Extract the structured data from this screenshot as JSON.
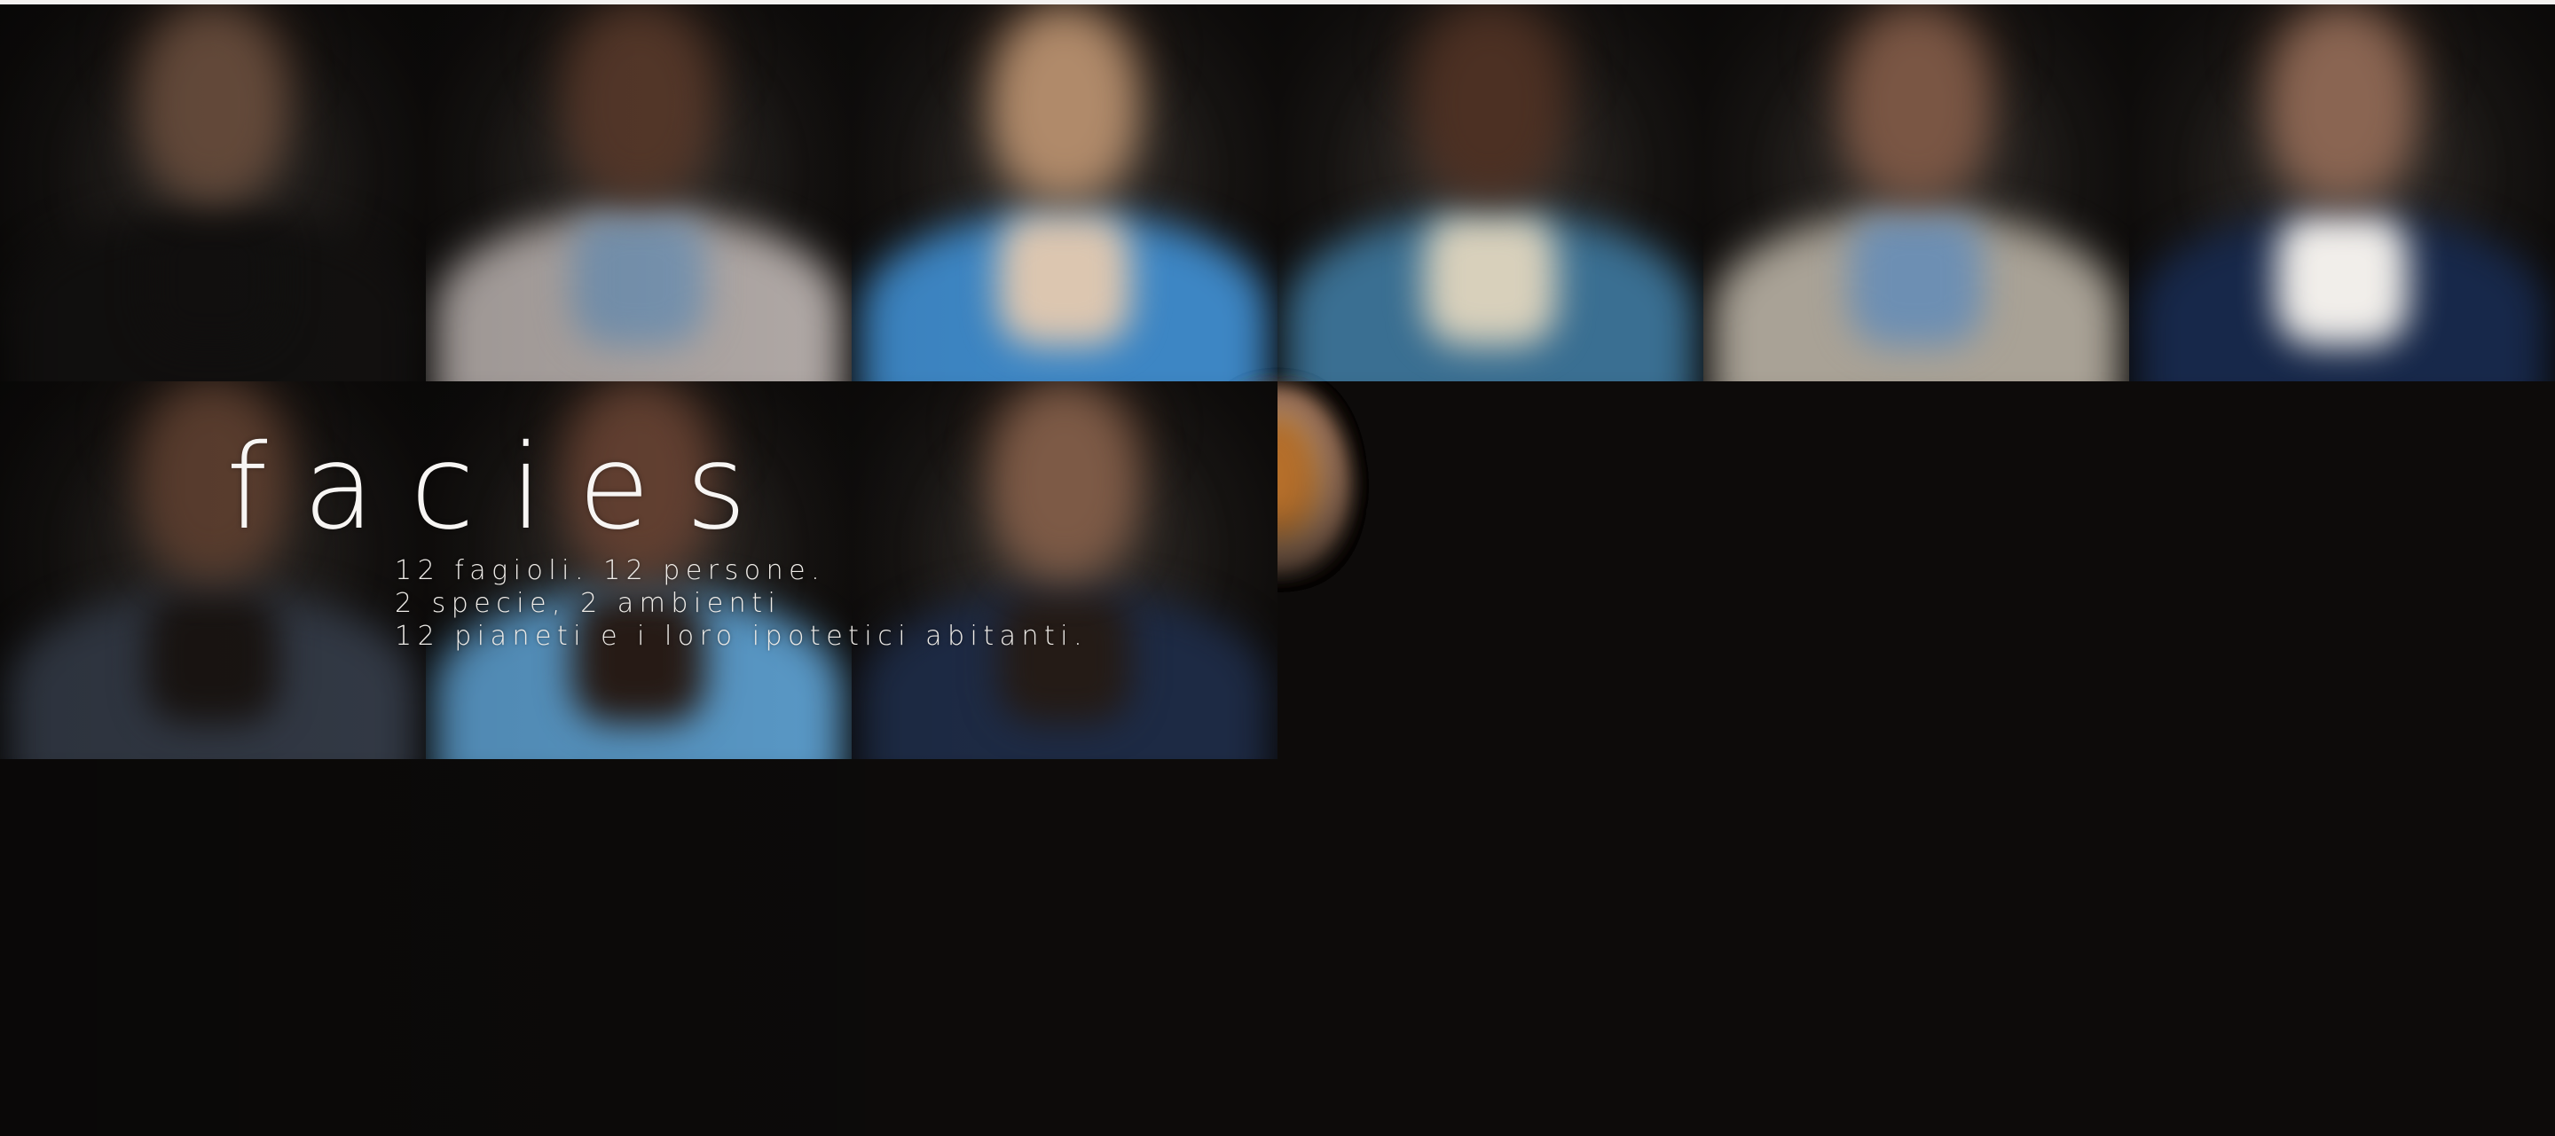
{
  "hero": {
    "title": "facies",
    "tagline": [
      "12 fagioli. 12 persone.",
      "2 specie, 2 ambienti",
      "12 pianeti e i loro ipotetici abitanti."
    ]
  },
  "tiles": [
    {
      "kind": "bean",
      "color": "#c98e2a"
    },
    {
      "kind": "person",
      "skin": "#7a5a47",
      "shirt": "#151312",
      "collar": "#151312"
    },
    {
      "kind": "bean",
      "color": "#231a45"
    },
    {
      "kind": "person",
      "skin": "#5a3b2c",
      "shirt": "#b8b0ad",
      "collar": "#7f9dbb"
    },
    {
      "kind": "bean",
      "color": "#d8d4cc"
    },
    {
      "kind": "person",
      "skin": "#b08a6a",
      "shirt": "#3d86c4",
      "collar": "#dcc6b0"
    },
    {
      "kind": "person",
      "skin": "#4c3023",
      "shirt": "#3a6f92",
      "collar": "#d8d0bb"
    },
    {
      "kind": "bean",
      "color": "#d37a1c"
    },
    {
      "kind": "person",
      "skin": "#7a5644",
      "shirt": "#a9a296",
      "collar": "#6d8fb3"
    },
    {
      "kind": "bean",
      "color": "#c05a2e"
    },
    {
      "kind": "person",
      "skin": "#8a6552",
      "shirt": "#17284a",
      "collar": "#f1eeea"
    },
    {
      "kind": "bean",
      "color": "#b1a69a"
    },
    {
      "kind": "bean",
      "color": "#4a0d1a"
    },
    {
      "kind": "person",
      "skin": "#6d4a38",
      "shirt": "#3b4351",
      "collar": "#1e1815"
    },
    {
      "kind": "bean",
      "color": "#e2dedb"
    },
    {
      "kind": "person",
      "skin": "#6a4535",
      "shirt": "#5d9fcf",
      "collar": "#2a1d17"
    },
    {
      "kind": "bean",
      "color": "#b8702a"
    },
    {
      "kind": "person",
      "skin": "#7d5a46",
      "shirt": "#1d2a44",
      "collar": "#241b16"
    }
  ]
}
